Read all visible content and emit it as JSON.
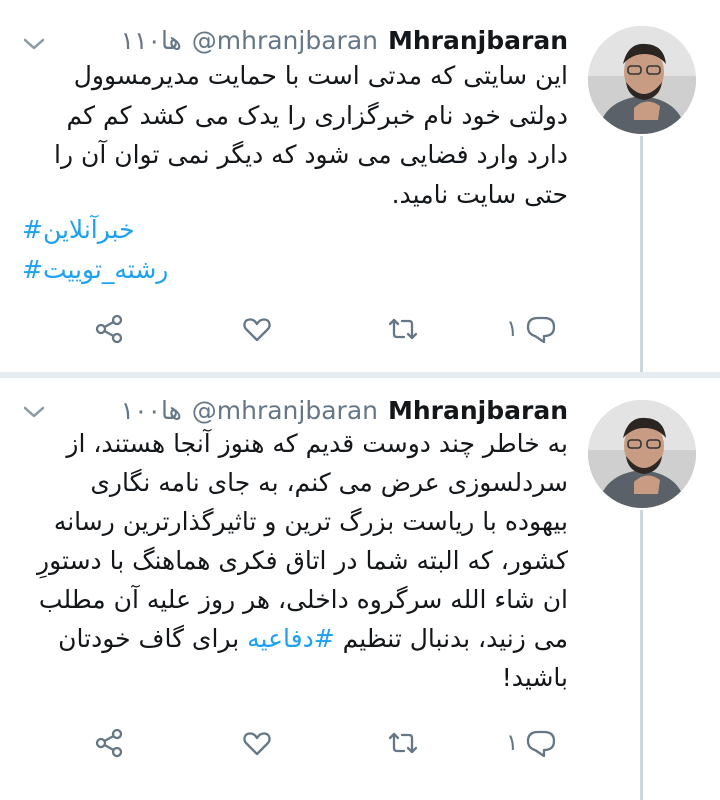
{
  "tweets": [
    {
      "display_name": "Mhranjbaran",
      "handle": "@mhranjbaran",
      "time": "۱۱ها",
      "time_suffix": "۰",
      "body": "این سایتی که مدتی است با حمایت مدیرمسوول دولتی خود نام خبرگزاری را یدک می کشد کم کم دارد وارد فضایی می شود که دیگر نمی توان آن را حتی سایت نامید.",
      "hashtags": [
        "خبرآنلاین#",
        "رشته_توییت#"
      ],
      "reply_count": "۱"
    },
    {
      "display_name": "Mhranjbaran",
      "handle": "@mhranjbaran",
      "time": "۱۰۰ها",
      "body_before": "به خاطر چند دوست قدیم که هنوز آنجا هستند، از سردلسوزی عرض می کنم، به جای نامه نگاری بیهوده با ریاست بزرگ ترین و تاثیرگذارترین رسانه کشور، که البته شما در اتاق فکری هماهنگ با دستورِ ان شاء الله سرگروه داخلی، هر روز علیه آن مطلب می زنید، بدنبال تنظیم ",
      "body_hashtag": "#دفاعیه",
      "body_after": " برای گاف خودتان باشید!",
      "reply_count": "۱"
    }
  ],
  "colors": {
    "accent": "#1da1f2",
    "muted": "#657786",
    "divider": "#e6ecf0"
  },
  "icons": [
    "chevron-down-icon",
    "share-icon",
    "like-icon",
    "retweet-icon",
    "reply-icon"
  ]
}
